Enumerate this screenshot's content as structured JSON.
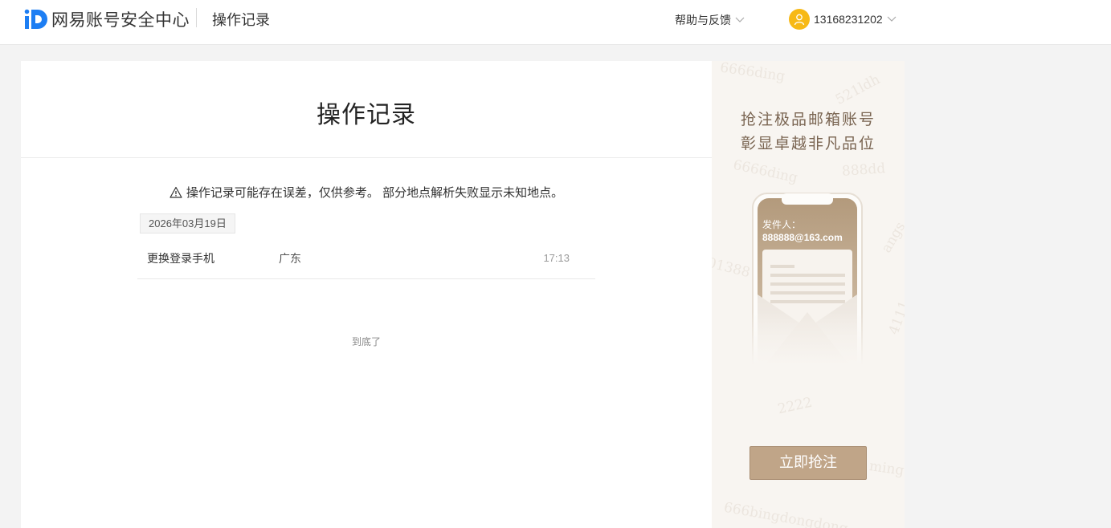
{
  "header": {
    "brand": "网易账号安全中心",
    "section": "操作记录",
    "help_label": "帮助与反馈",
    "user_phone": "13168231202"
  },
  "main": {
    "title": "操作记录",
    "notice": "操作记录可能存在误差，仅供参考。 部分地点解析失败显示未知地点。",
    "groups": [
      {
        "date": "2026年03月19日",
        "records": [
          {
            "action": "更换登录手机",
            "location": "广东",
            "time": "17:13"
          }
        ]
      }
    ],
    "end_text": "到底了"
  },
  "ad": {
    "headline_line1": "抢注极品邮箱账号",
    "headline_line2": "彰显卓越非凡品位",
    "sender_label": "发件人：",
    "sender_email": "888888@163.com",
    "cta_label": "立即抢注",
    "watermarks": [
      "521ldh",
      "888dd",
      "6666ding",
      "01388",
      "2222",
      "angs",
      "ming",
      "666bingdongdong",
      "4111"
    ]
  },
  "colors": {
    "brand_blue": "#1d7ef3",
    "avatar_yellow": "#f7b916",
    "ad_gold": "#c0a588",
    "ad_text": "#7a6552"
  }
}
